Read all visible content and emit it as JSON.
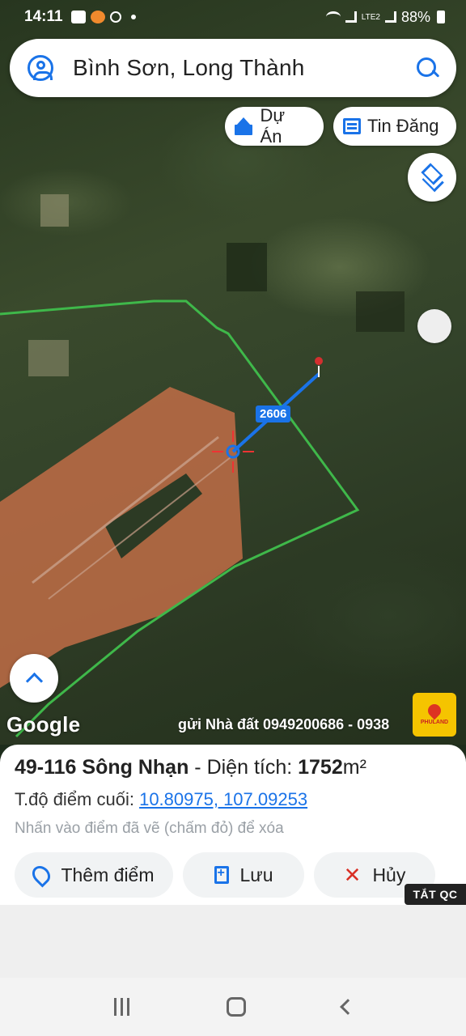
{
  "status_bar": {
    "time": "14:11",
    "battery": "88%",
    "network": "LTE2"
  },
  "search": {
    "query": "Bình Sơn, Long Thành",
    "left_icon": "account-icon",
    "right_icon": "search-icon"
  },
  "chips": {
    "du_an": "Dự Án",
    "tin_dang": "Tin Đăng"
  },
  "map": {
    "distance_label": "2606",
    "google_logo": "Google",
    "ticker": "gửi Nhà đất 0949200686 - 0938",
    "brand_logo": "PHULAND",
    "boundary_color": "#3fb84a",
    "route_color": "#1a73e8",
    "marker_color": "#d32f2f"
  },
  "panel": {
    "title_name": "49-116 Sông Nhạn",
    "title_sep": " - Diện tích: ",
    "area_value": "1752",
    "area_unit": "m²",
    "coord_label": "T.độ điểm cuối: ",
    "coord_value": "10.80975, 107.09253",
    "hint": "Nhấn vào điểm đã vẽ (chấm đỏ) để xóa",
    "buttons": {
      "add_point": "Thêm điểm",
      "save": "Lưu",
      "cancel": "Hủy"
    }
  },
  "ad_close": "TẮT QC",
  "colors": {
    "accent": "#1a73e8",
    "danger": "#d93025"
  }
}
